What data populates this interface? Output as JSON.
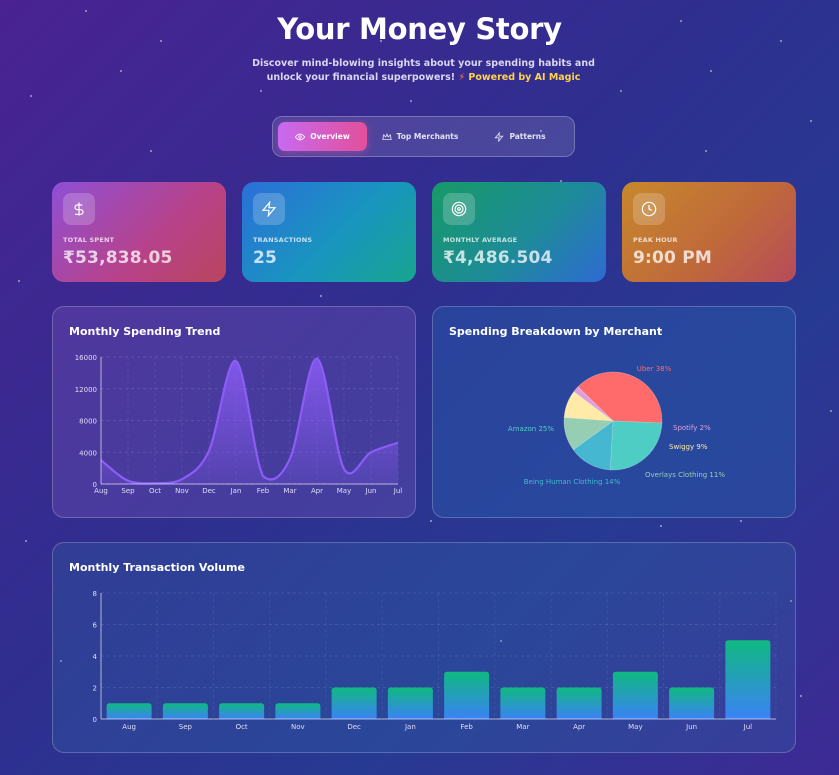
{
  "header": {
    "title": "Your Money Story",
    "subtitle": "Discover mind-blowing insights about your spending habits and unlock your financial superpowers!",
    "powered": "Powered by AI Magic"
  },
  "tabs": [
    {
      "label": "Overview",
      "icon": "eye-icon",
      "active": true
    },
    {
      "label": "Top Merchants",
      "icon": "crown-icon",
      "active": false
    },
    {
      "label": "Patterns",
      "icon": "zap-icon",
      "active": false
    }
  ],
  "stats": [
    {
      "label": "TOTAL SPENT",
      "value": "₹53,838.05",
      "icon": "dollar-icon"
    },
    {
      "label": "TRANSACTIONS",
      "value": "25",
      "icon": "zap-icon"
    },
    {
      "label": "MONTHLY AVERAGE",
      "value": "₹4,486.504",
      "icon": "target-icon"
    },
    {
      "label": "PEAK HOUR",
      "value": "9:00 PM",
      "icon": "clock-icon"
    }
  ],
  "colors": {
    "line": "#8b5cf6",
    "bar_top": "#10b981",
    "bar_bottom": "#3b82f6",
    "pie": [
      "#ff6b6b",
      "#4ecdc4",
      "#45b7d1",
      "#96ceb4",
      "#ffeaa7",
      "#dda0dd"
    ]
  },
  "chart_data": [
    {
      "type": "area",
      "title": "Monthly Spending Trend",
      "categories": [
        "Aug",
        "Sep",
        "Oct",
        "Nov",
        "Dec",
        "Jan",
        "Feb",
        "Mar",
        "Apr",
        "May",
        "Jun",
        "Jul"
      ],
      "values": [
        3000,
        400,
        100,
        600,
        4200,
        15500,
        1000,
        3200,
        15800,
        1900,
        4000,
        5200
      ],
      "ylim": [
        0,
        16000
      ],
      "yticks": [
        "0",
        "4000",
        "8000",
        "12000",
        "16000"
      ],
      "grid": true
    },
    {
      "type": "pie",
      "title": "Spending Breakdown by Merchant",
      "slices": [
        {
          "label": "Uber 38%",
          "value": 38
        },
        {
          "label": "Amazon 25%",
          "value": 25
        },
        {
          "label": "Being Human Clothing 14%",
          "value": 14
        },
        {
          "label": "Overlays Clothing 11%",
          "value": 11
        },
        {
          "label": "Swiggy 9%",
          "value": 9
        },
        {
          "label": "Spotify 2%",
          "value": 2
        }
      ]
    },
    {
      "type": "bar",
      "title": "Monthly Transaction Volume",
      "categories": [
        "Aug",
        "Sep",
        "Oct",
        "Nov",
        "Dec",
        "Jan",
        "Feb",
        "Mar",
        "Apr",
        "May",
        "Jun",
        "Jul"
      ],
      "values": [
        1,
        1,
        1,
        1,
        2,
        2,
        3,
        2,
        2,
        3,
        2,
        5
      ],
      "ylim": [
        0,
        8
      ],
      "yticks": [
        "0",
        "2",
        "4",
        "6",
        "8"
      ],
      "grid": true
    }
  ]
}
